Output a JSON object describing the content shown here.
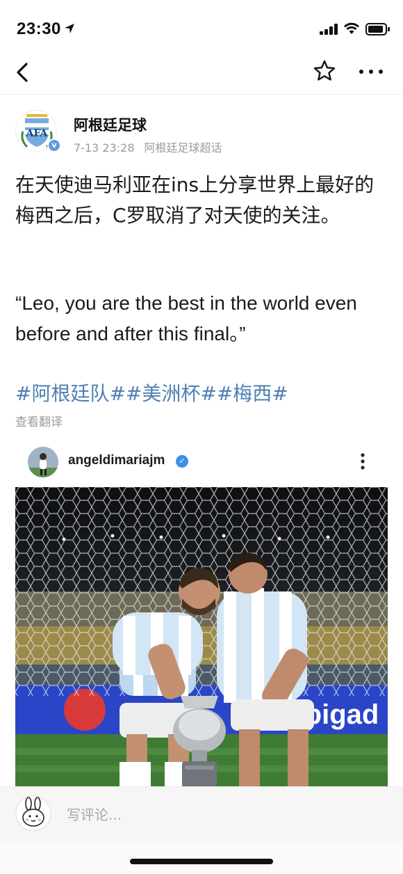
{
  "status_bar": {
    "time": "23:30"
  },
  "post": {
    "author": "阿根廷足球",
    "date": "7-13 23:28",
    "source": "阿根廷足球超话",
    "verified_mark": "v",
    "text": "在天使迪马利亚在ins上分享世界上最好的梅西之后，C罗取消了对天使的关注。",
    "quote": "“Leo,  you are the best in the world even before and after this final。”",
    "hashtags": "#阿根廷队##美洲杯##梅西#",
    "translate_label": "查看翻译"
  },
  "embed": {
    "username": "angeldimariajm",
    "verified_mark": "✓"
  },
  "comment": {
    "placeholder": "写评论..."
  },
  "colors": {
    "link": "#4e7fb3",
    "meta": "#9a9a9a",
    "verify": "#3d8fe8"
  }
}
